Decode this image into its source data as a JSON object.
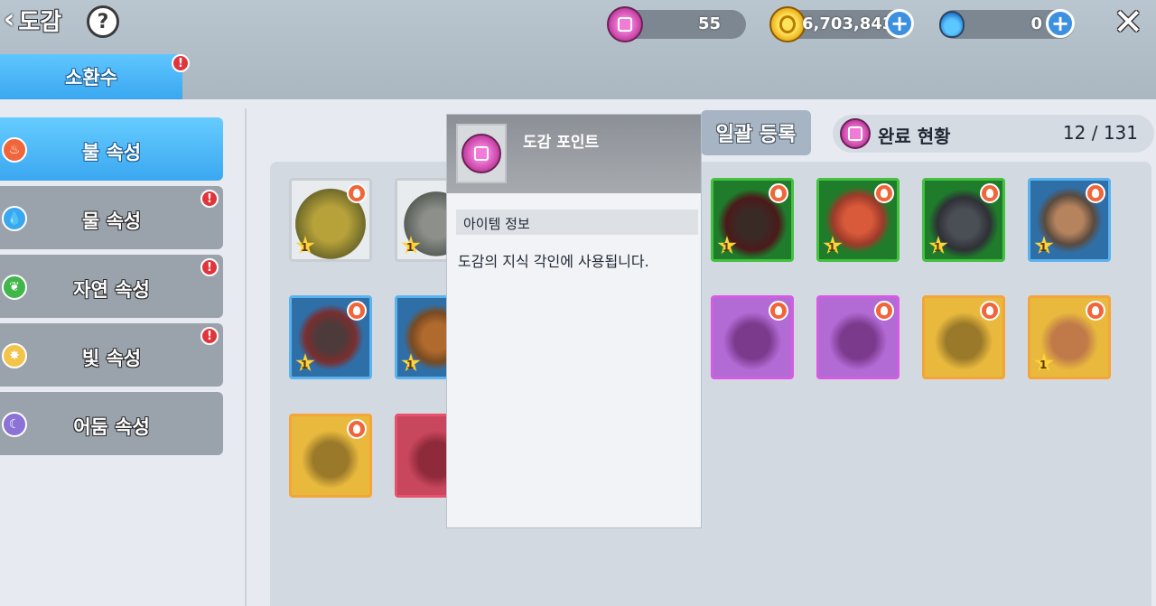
{
  "header": {
    "title": "도감",
    "help_label": "?",
    "close_label": "✕"
  },
  "currencies": [
    {
      "name": "dogam-point",
      "value": "55",
      "color": "#d84fb5"
    },
    {
      "name": "gold",
      "value": "6,703,843",
      "color": "#f2b71c"
    },
    {
      "name": "potion",
      "value": "0",
      "color": "#3aa7f0"
    }
  ],
  "tabs": {
    "main": {
      "label": "소환수",
      "alert": "!"
    }
  },
  "sidebar": {
    "items": [
      {
        "label": "불 속성",
        "icon": "fire-icon",
        "color": "#f0663a",
        "active": true,
        "alert": ""
      },
      {
        "label": "물 속성",
        "icon": "water-icon",
        "color": "#3aa7f0",
        "active": false,
        "alert": "!"
      },
      {
        "label": "자연 속성",
        "icon": "leaf-icon",
        "color": "#41b64a",
        "active": false,
        "alert": "!"
      },
      {
        "label": "빛 속성",
        "icon": "sun-icon",
        "color": "#f2c44a",
        "active": false,
        "alert": "!"
      },
      {
        "label": "어둠 속성",
        "icon": "moon-icon",
        "color": "#8a72d6",
        "active": false,
        "alert": ""
      }
    ]
  },
  "toolbar": {
    "bulk_register_label": "일괄 등록",
    "completion_label": "완료 현황",
    "completion_count": "12 / 131"
  },
  "tooltip": {
    "item_name": "도감 포인트",
    "section_label": "아이템 정보",
    "description": "도감의 지식 각인에 사용됩니다."
  },
  "cards": [
    {
      "rarity": "gray",
      "owned": true,
      "level": "1"
    },
    {
      "rarity": "gray",
      "owned": true,
      "level": "1"
    },
    {
      "rarity": "green",
      "owned": true,
      "level": "1"
    },
    {
      "rarity": "green",
      "owned": true,
      "level": "1"
    },
    {
      "rarity": "green",
      "owned": true,
      "level": "1"
    },
    {
      "rarity": "blue",
      "owned": true,
      "level": "1"
    },
    {
      "rarity": "blue",
      "owned": true,
      "level": "1"
    },
    {
      "rarity": "blue",
      "owned": true,
      "level": "1"
    },
    {
      "rarity": "purple",
      "owned": false,
      "level": ""
    },
    {
      "rarity": "purple",
      "owned": false,
      "level": ""
    },
    {
      "rarity": "orange",
      "owned": false,
      "level": ""
    },
    {
      "rarity": "orange",
      "owned": true,
      "level": "1"
    },
    {
      "rarity": "orange",
      "owned": false,
      "level": ""
    },
    {
      "rarity": "red",
      "owned": false,
      "level": ""
    }
  ]
}
